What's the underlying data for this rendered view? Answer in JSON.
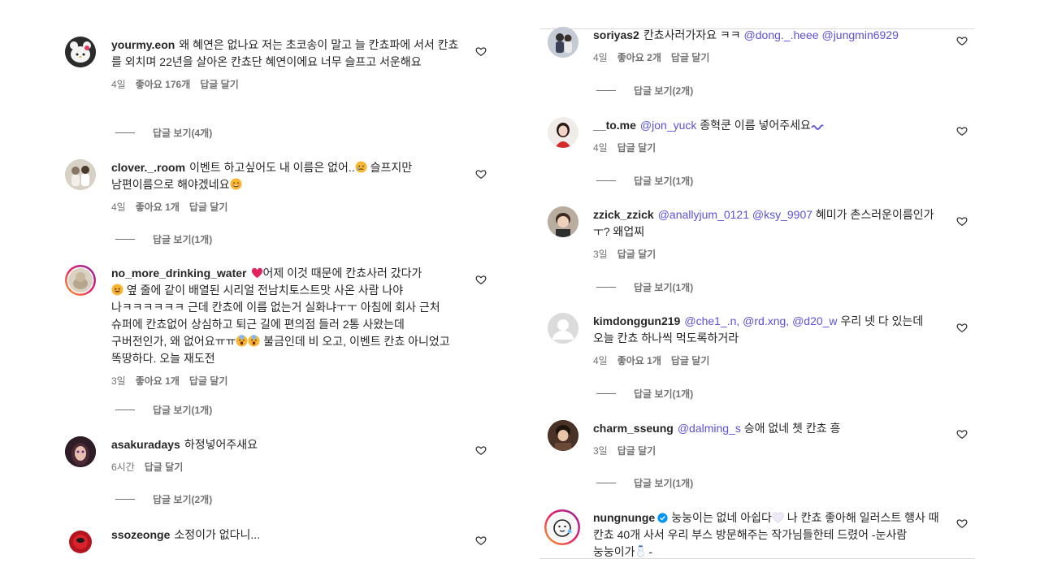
{
  "left": [
    {
      "username": "yourmy.eon",
      "text": "왜 혜연은 없나요 저는 초코송이 말고 늘 칸쵸파에 서서 칸쵸 를 외치며 22년을 살아온 칸쵸단 혜연이에요 너무 슬프고 서운해요",
      "time": "4일",
      "likes": "좋아요 176개",
      "reply": "답글 달기",
      "view_replies": "답글 보기(4개)"
    },
    {
      "username": "clover._.room",
      "text": "이벤트 하고싶어도 내 이름은 없어..",
      "text2": " 슬프지만 남편이름으로 해야겠네요",
      "time": "4일",
      "likes": "좋아요 1개",
      "reply": "답글 달기",
      "view_replies": "답글 보기(1개)"
    },
    {
      "username": "no_more_drinking_water",
      "text_a": "어제 이것 때문에 칸쵸사러 갔다가",
      "text_b": " 옆 줄에 같이 배열된 시리얼 전남치토스트맛 사온 사람 나야 나ㅋㅋㅋㅋㅋㅋ 근데 칸쵸에 이름 없는거 실화냐ㅜㅜ 아침에 회사 근처 슈퍼에 칸쵸없어 상심하고 퇴근 길에 편의점 들러 2통 사왔는데 구버전인가, 왜 없어요ㅠㅠ",
      "text_c": " 불금인데 비 오고, 이벤트 칸쵸 아니었고 똑땅하다. 오늘 재도전",
      "time": "3일",
      "likes": "좋아요 1개",
      "reply": "답글 달기",
      "view_replies": "답글 보기(1개)"
    },
    {
      "username": "asakuradays",
      "text": "하정넣어주새요",
      "time": "6시간",
      "reply": "답글 달기",
      "view_replies": "답글 보기(2개)"
    },
    {
      "username": "ssozeonge",
      "text": "소정이가 없다니..."
    }
  ],
  "right": [
    {
      "username": "soriyas2",
      "text": "칸쵸사러가자요 ㅋㅋ",
      "mentions": "@dong._.heee @jungmin6929",
      "time": "4일",
      "likes": "좋아요 2개",
      "reply": "답글 달기",
      "view_replies": "답글 보기(2개)"
    },
    {
      "username": "__to.me",
      "mention": "@jon_yuck",
      "text": "종혁쿤 이름 넣어주세요",
      "time": "4일",
      "reply": "답글 달기",
      "view_replies": "답글 보기(1개)"
    },
    {
      "username": "zzick_zzick",
      "mentions": "@anallyjum_0121 @ksy_9907",
      "text": "혜미가 촌스러운이름인가 ㅜ? 왜업찌",
      "time": "3일",
      "reply": "답글 달기",
      "view_replies": "답글 보기(1개)"
    },
    {
      "username": "kimdonggun219",
      "mentions": "@che1_.n, @rd.xng, @d20_w",
      "text": "우리 넷 다 있는데 오늘 칸쵸 하나씩 먹도록하거라",
      "time": "4일",
      "likes": "좋아요 1개",
      "reply": "답글 달기",
      "view_replies": "답글 보기(1개)"
    },
    {
      "username": "charm_sseung",
      "mention": "@dalming_s",
      "text": "승애 없네 쳇 칸쵸 흥",
      "time": "3일",
      "reply": "답글 달기",
      "view_replies": "답글 보기(1개)"
    },
    {
      "username": "nungnunge",
      "text": "눙눙이는 없네 아쉽다",
      "text2": " 나 칸쵸 좋아해 일러스트 행사 때 칸쵸 40개 사서 우리 부스 방문해주는 작가님들한테 드렸어 -눈사람 눙눙이가",
      "text3": " -"
    }
  ],
  "colors": {
    "mention": "#5b51d8",
    "meta": "#737373",
    "text": "#262626",
    "verified": "#0095f6",
    "heart_emoji": "#e0245e"
  }
}
